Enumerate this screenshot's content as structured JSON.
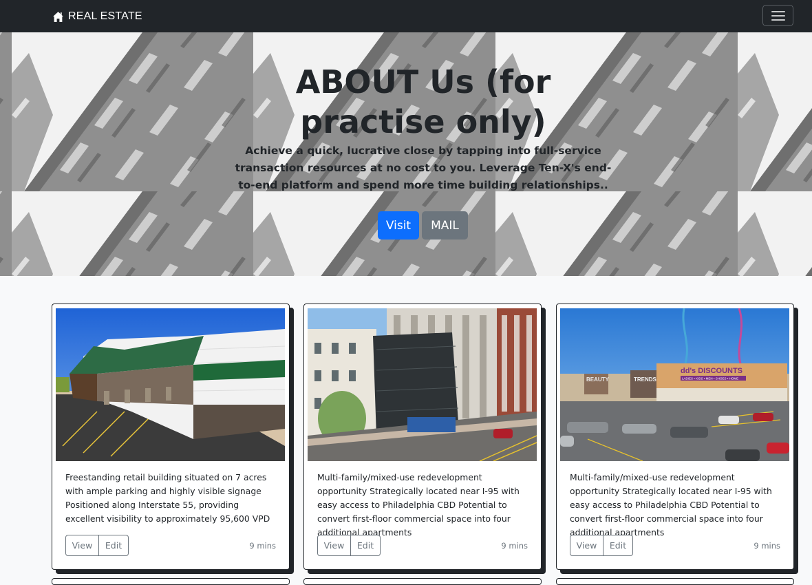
{
  "navbar": {
    "brand": "REAL ESTATE",
    "brand_icon": "home-icon",
    "toggler_icon": "hamburger-menu-icon"
  },
  "hero": {
    "title": "ABOUT Us (for practise only)",
    "lead": "Achieve a quick, lucrative close by tapping into full-service transaction resources at no cost to you. Leverage Ten-X's end-to-end platform and spend more time building relationships..",
    "buttons": {
      "visit": "Visit",
      "mail": "MAIL"
    }
  },
  "cards": [
    {
      "text": "Freestanding retail building situated on 7 acres with ample parking and highly visible signage Positioned along Interstate 55, providing excellent visibility to approximately 95,600 VPD",
      "view": "View",
      "edit": "Edit",
      "time": "9 mins"
    },
    {
      "text": "Multi-family/mixed-use redevelopment opportunity Strategically located near I-95 with easy access to Philadelphia CBD Potential to convert first-floor commercial space into four additional apartments",
      "view": "View",
      "edit": "Edit",
      "time": "9 mins"
    },
    {
      "text": "Multi-family/mixed-use redevelopment opportunity Strategically located near I-95 with easy access to Philadelphia CBD Potential to convert first-floor commercial space into four additional apartments",
      "view": "View",
      "edit": "Edit",
      "time": "9 mins"
    }
  ],
  "image_signs": {
    "beauty": "BEAUTY",
    "trends": "TRENDS",
    "dds": "dd's DISCOUNTS",
    "dds_sub": "LADIES • KIDS • MEN • SHOES • HOME"
  },
  "colors": {
    "navbar_bg": "#212529",
    "primary": "#0d6efd",
    "secondary": "#6c757d",
    "page_bg": "#f8f9fa"
  }
}
